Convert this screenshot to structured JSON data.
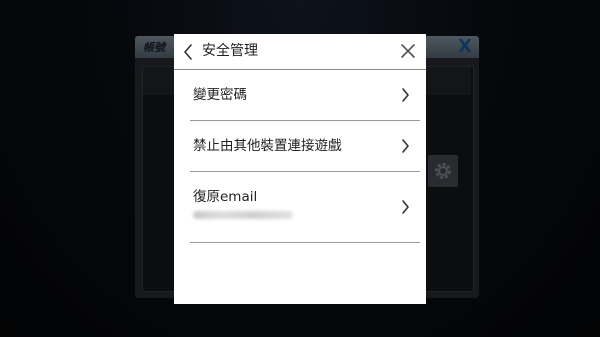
{
  "background_window": {
    "title": "帳號",
    "close_glyph": "X"
  },
  "dialog": {
    "title": "安全管理",
    "items": [
      {
        "label": "變更密碼"
      },
      {
        "label": "禁止由其他裝置連接遊戲"
      },
      {
        "label": "復原email"
      }
    ]
  },
  "icons": {
    "back": "chevron-left-icon",
    "close": "close-icon",
    "row_arrow": "chevron-right-icon",
    "settings": "gear-icon"
  },
  "colors": {
    "dialog_bg": "#ffffff",
    "text": "#222222",
    "divider": "#9a9a9a",
    "bg_close": "#1e5fa8"
  }
}
